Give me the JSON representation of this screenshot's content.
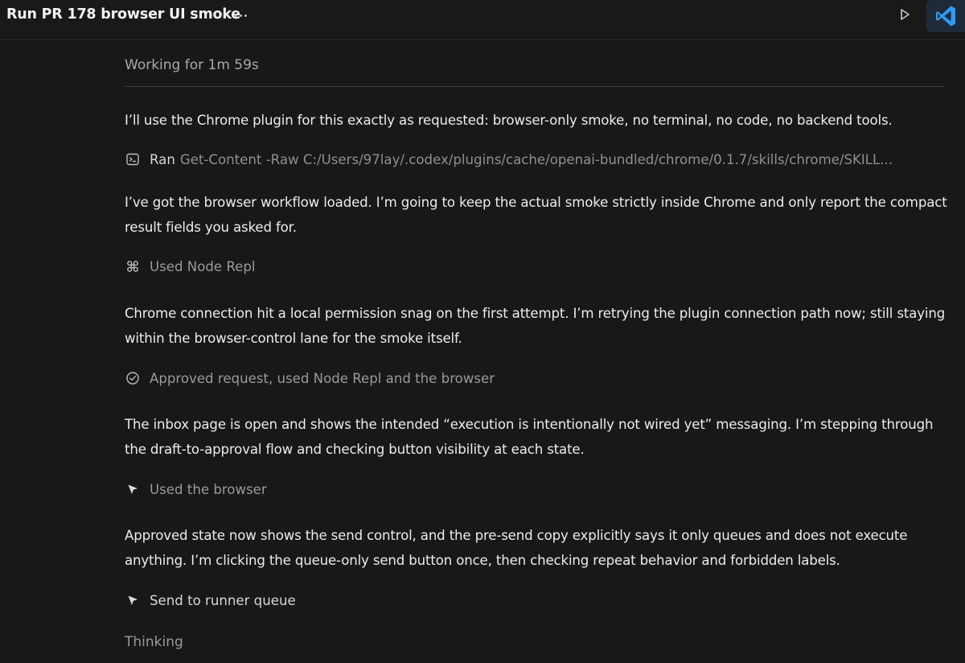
{
  "header": {
    "title": "Run PR 178 browser UI smoke",
    "more_icon": "ellipsis-icon",
    "run_icon": "play-icon",
    "app_icon": "vscode-icon"
  },
  "status": {
    "working": "Working for 1m 59s"
  },
  "messages": [
    {
      "text": "I’ll use the Chrome plugin for this exactly as requested: browser-only smoke, no terminal, no code, no backend tools."
    },
    {
      "text": "I’ve got the browser workflow loaded. I’m going to keep the actual smoke strictly inside Chrome and only report the compact result fields you asked for."
    },
    {
      "text": "Chrome connection hit a local permission snag on the first attempt. I’m retrying the plugin connection path now; still staying within the browser-control lane for the smoke itself."
    },
    {
      "text": "The inbox page is open and shows the intended “execution is intentionally not wired yet” messaging. I’m stepping through the draft-to-approval flow and checking button visibility at each state."
    },
    {
      "text": "Approved state now shows the send control, and the pre-send copy explicitly says it only queues and does not execute anything. I’m clicking the queue-only send button once, then checking repeat behavior and forbidden labels."
    }
  ],
  "actions": [
    {
      "icon": "terminal-icon",
      "verb": "Ran",
      "command": "Get-Content -Raw C:/Users/97lay/.codex/plugins/cache/openai-bundled/chrome/0.1.7/skills/chrome/SKILL..."
    },
    {
      "icon": "command-icon",
      "label": "Used Node Repl"
    },
    {
      "icon": "check-circle-icon",
      "label": "Approved request, used Node Repl and the browser"
    },
    {
      "icon": "cursor-icon",
      "label": "Used the browser"
    },
    {
      "icon": "cursor-icon",
      "label": "Send to runner queue"
    }
  ],
  "footer": {
    "thinking": "Thinking"
  },
  "colors": {
    "background": "#181818",
    "text": "#ececec",
    "muted": "#9a9a9a",
    "accent": "#2f9bf0"
  }
}
